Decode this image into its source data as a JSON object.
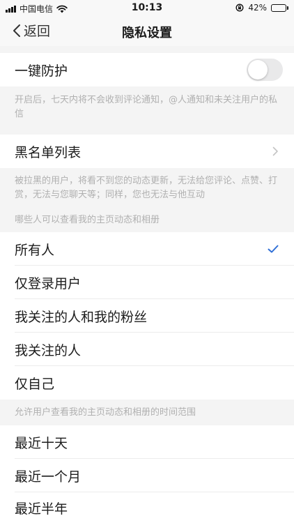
{
  "status_bar": {
    "carrier": "中国电信",
    "time": "10:13",
    "battery": "42%",
    "battery_level": 0.42,
    "icons": [
      "signal-icon",
      "wifi-icon",
      "orientation-lock-icon",
      "battery-icon"
    ]
  },
  "nav": {
    "back_label": "返回",
    "title": "隐私设置"
  },
  "protection": {
    "label": "一键防护",
    "enabled": false,
    "hint": "开启后，七天内将不会收到评论通知，@人通知和未关注用户的私信"
  },
  "blacklist": {
    "label": "黑名单列表",
    "hint": "被拉黑的用户，将看不到您的动态更新，无法给您评论、点赞、打赏，无法与您聊天等；同样，您也无法与他互动"
  },
  "visibility": {
    "header": "哪些人可以查看我的主页动态和相册",
    "options": [
      {
        "label": "所有人",
        "selected": true
      },
      {
        "label": "仅登录用户",
        "selected": false
      },
      {
        "label": "我关注的人和我的粉丝",
        "selected": false
      },
      {
        "label": "我关注的人",
        "selected": false
      },
      {
        "label": "仅自己",
        "selected": false
      }
    ]
  },
  "time_range": {
    "header": "允许用户查看我的主页动态和相册的时间范围",
    "options": [
      {
        "label": "最近十天"
      },
      {
        "label": "最近一个月"
      },
      {
        "label": "最近半年"
      }
    ]
  },
  "colors": {
    "accent": "#2f6fd6",
    "background": "#f4f4f4",
    "hint_text": "#b0b0b0"
  }
}
